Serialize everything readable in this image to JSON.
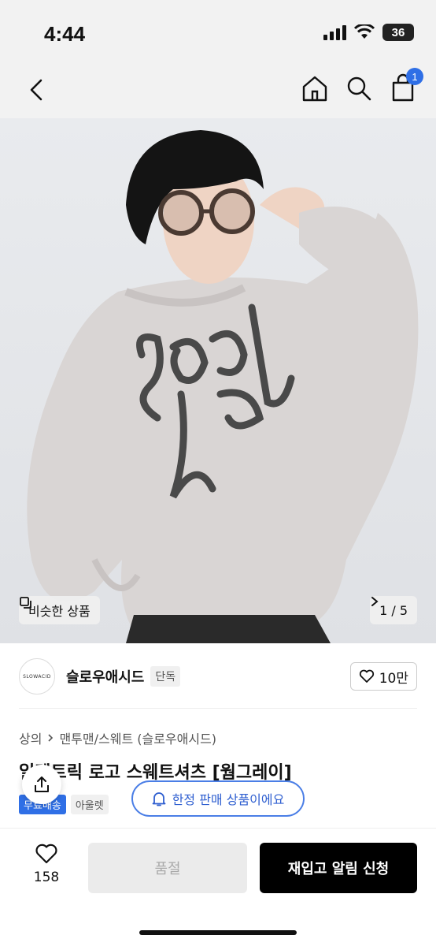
{
  "status": {
    "time": "4:44",
    "battery": "36"
  },
  "nav": {
    "cart_count": "1"
  },
  "hero": {
    "similar_label": "비슷한 상품",
    "page_indicator": "1 / 5"
  },
  "brand": {
    "logo_text": "SLOWACID",
    "name": "슬로우애시드",
    "tag": "단독",
    "likes": "10만"
  },
  "breadcrumb": [
    "상의",
    "맨투맨/스웨트 (슬로우애시드)"
  ],
  "product": {
    "title": "일렉트릭 로고 스웨트셔츠 [웜그레이]",
    "tags": [
      "무료배송",
      "아울렛"
    ]
  },
  "limited": {
    "label": "한정 판매 상품이에요"
  },
  "bottom": {
    "wish_count": "158",
    "soldout_label": "품절",
    "restock_label": "재입고 알림 신청"
  },
  "colors": {
    "accent": "#2f6fe6",
    "sweatshirt": "#d9d5d4"
  }
}
